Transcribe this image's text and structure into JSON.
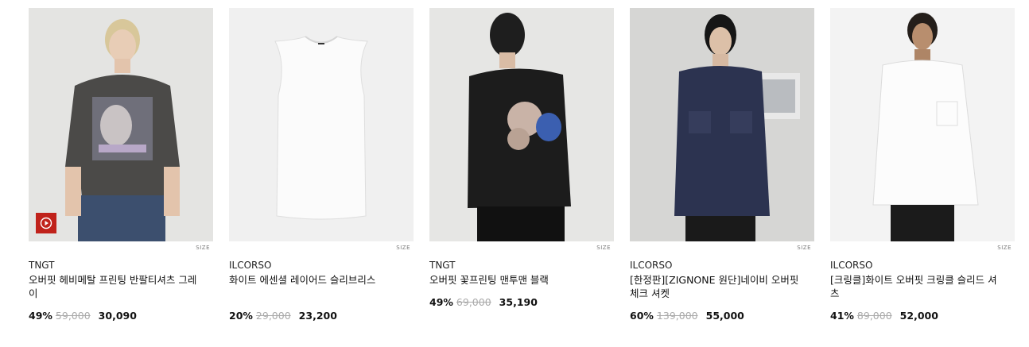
{
  "products": [
    {
      "brand": "TNGT",
      "name": "오버핏 헤비메탈 프린팅 반팔티셔츠 그레이",
      "discount": "49%",
      "original_price": "59,000",
      "sale_price": "30,090",
      "size_label": "SIZE",
      "has_video": true
    },
    {
      "brand": "ILCORSO",
      "name": "화이트 에센셜 레이어드 슬리브리스",
      "discount": "20%",
      "original_price": "29,000",
      "sale_price": "23,200",
      "size_label": "SIZE",
      "has_video": false
    },
    {
      "brand": "TNGT",
      "name": "오버핏 꽃프린팅 맨투맨 블랙",
      "discount": "49%",
      "original_price": "69,000",
      "sale_price": "35,190",
      "size_label": "SIZE",
      "has_video": false
    },
    {
      "brand": "ILCORSO",
      "name": "[한정판][ZIGNONE 원단]네이비 오버핏 체크 셔켓",
      "discount": "60%",
      "original_price": "139,000",
      "sale_price": "55,000",
      "size_label": "SIZE",
      "has_video": false
    },
    {
      "brand": "ILCORSO",
      "name": "[크링클]화이트 오버핏 크링클 슬리드 셔츠",
      "discount": "41%",
      "original_price": "89,000",
      "sale_price": "52,000",
      "size_label": "SIZE",
      "has_video": false
    }
  ],
  "colors": {
    "accent_video": "#c0221b",
    "strike": "#aaaaaa"
  }
}
